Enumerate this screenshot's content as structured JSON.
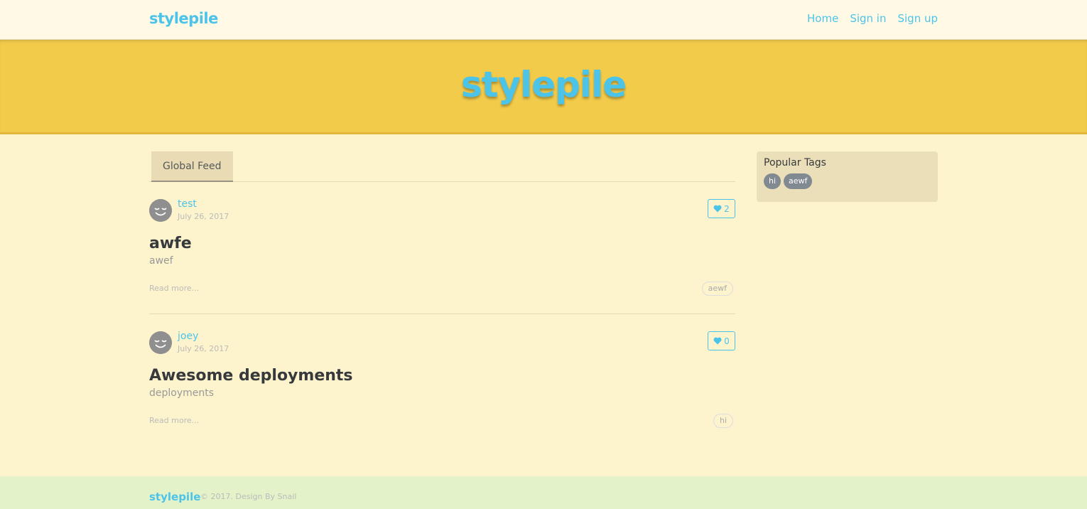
{
  "navbar": {
    "brand": "stylepile",
    "links": [
      "Home",
      "Sign in",
      "Sign up"
    ]
  },
  "banner": {
    "title": "stylepile"
  },
  "feed": {
    "tab": "Global Feed",
    "articles": [
      {
        "author": "test",
        "date": "July 26, 2017",
        "favorites": "2",
        "title": "awfe",
        "description": "awef",
        "read_more": "Read more...",
        "tag": "aewf"
      },
      {
        "author": "joey",
        "date": "July 26, 2017",
        "favorites": "0",
        "title": "Awesome deployments",
        "description": "deployments",
        "read_more": "Read more...",
        "tag": "hi"
      }
    ]
  },
  "sidebar": {
    "heading": "Popular Tags",
    "tags": [
      "hi",
      "aewf"
    ]
  },
  "footer": {
    "logo": "stylepile",
    "attribution": "© 2017. Design By Snail"
  },
  "colors": {
    "accent": "#4cc4ea",
    "banner": "#f2cb4b",
    "background": "#fdf3cc",
    "footer": "#e3f2c9"
  },
  "icons": [
    "smiley-avatar-icon",
    "heart-icon"
  ]
}
